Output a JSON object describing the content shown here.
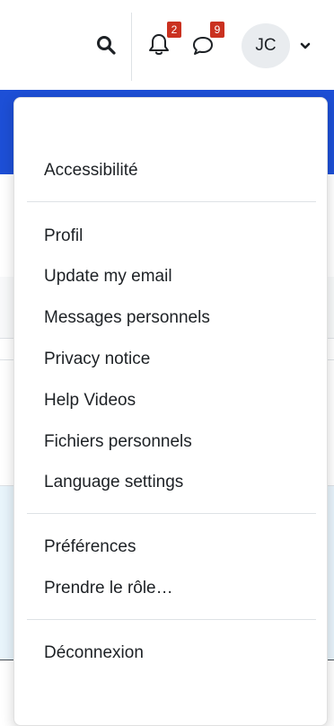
{
  "navbar": {
    "icons": {
      "search": "search-icon",
      "notifications": "bell-icon",
      "messages": "chat-bubble-icon",
      "user_menu_toggle": "chevron-down-icon"
    },
    "notification_count": "2",
    "message_count": "9",
    "avatar_initials": "JC"
  },
  "user_menu": {
    "items": [
      "Accessibilité",
      "Profil",
      "Update my email",
      "Messages personnels",
      "Privacy notice",
      "Help Videos",
      "Fichiers personnels",
      "Language settings",
      "Préférences",
      "Prendre le rôle…",
      "Déconnexion"
    ]
  },
  "colors": {
    "brand_blue": "#1d4fd6",
    "badge_red": "#ca3120",
    "avatar_bg": "#e9ecef",
    "text": "#1d2125"
  }
}
